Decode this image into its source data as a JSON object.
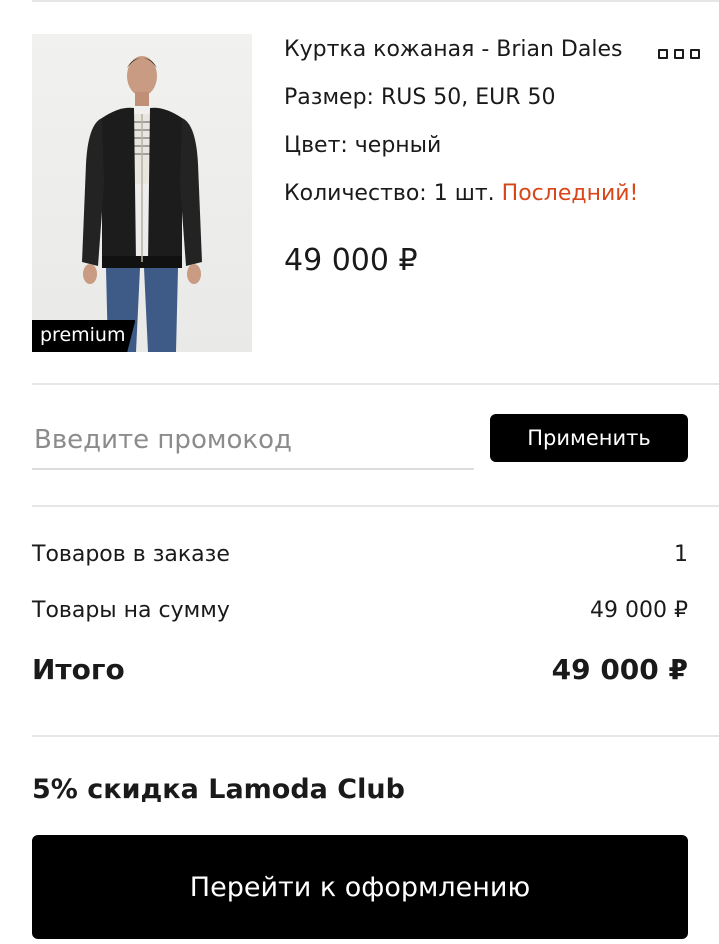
{
  "cart_item": {
    "badge": "premium",
    "title": "Куртка кожаная - Brian Dales",
    "size_label": "Размер: RUS 50, EUR 50",
    "color_label": "Цвет: черный",
    "quantity_label": "Количество: 1 шт.",
    "quantity_note": "Последний!",
    "price": "49 000 ₽",
    "menu_icon": "more-icon"
  },
  "promo": {
    "placeholder": "Введите промокод",
    "apply_label": "Применить"
  },
  "summary": {
    "items_count_label": "Товаров в заказе",
    "items_count_value": "1",
    "items_sum_label": "Товары на сумму",
    "items_sum_value": "49 000 ₽",
    "total_label": "Итого",
    "total_value": "49 000 ₽"
  },
  "club_discount": "5% скидка Lamoda Club",
  "checkout_label": "Перейти к оформлению",
  "colors": {
    "accent_warning": "#d7471a",
    "button_bg": "#000000"
  }
}
